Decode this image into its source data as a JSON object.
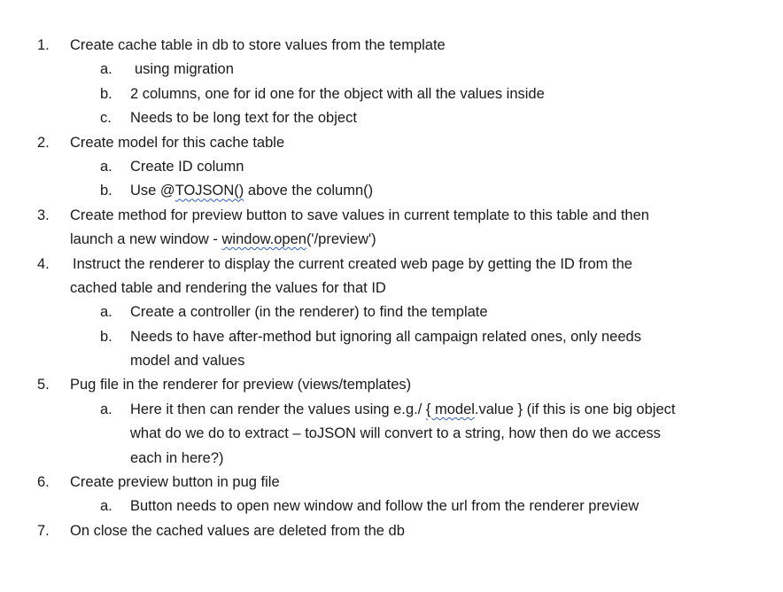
{
  "doc": {
    "items": [
      {
        "num": "1.",
        "text": "Create cache table in db to store values from the template"
      },
      {
        "num": "a.",
        "text": "using migration"
      },
      {
        "num": "b.",
        "text": "2 columns, one for id one for the object with all the values inside"
      },
      {
        "num": "c.",
        "text": "Needs to be long text for the object"
      },
      {
        "num": "2.",
        "text": "Create model for this cache table"
      },
      {
        "num": "a.",
        "text": "Create ID column"
      },
      {
        "num": "b.",
        "pre": "Use @",
        "link": "TOJSON()",
        "post": " above the column()"
      },
      {
        "num": "3.",
        "text": "Create method for preview button to save values in current template to this table and then"
      },
      {
        "pre": "launch a new window - ",
        "link": "window.open",
        "post": "('/preview')"
      },
      {
        "num": "4.",
        "text": "Instruct the renderer to display the current created web page by getting the ID from the"
      },
      {
        "text": "cached table and rendering the values for that ID"
      },
      {
        "num": "a.",
        "text": "Create a controller (in the renderer) to find the template"
      },
      {
        "num": "b.",
        "text": "Needs to have after-method but ignoring all campaign related ones, only needs"
      },
      {
        "text": "model and values"
      },
      {
        "num": "5.",
        "text": "Pug file in the renderer for preview (views/templates)"
      },
      {
        "num": "a.",
        "pre": "Here it then can render the values using e.g./ ",
        "link": "{ model",
        "post": ".value } (if this is one big object"
      },
      {
        "text": "what do we do to extract – toJSON will convert to a string, how then do we access"
      },
      {
        "text": "each in here?)"
      },
      {
        "num": "6.",
        "text": "Create preview button in pug file"
      },
      {
        "num": "a.",
        "text": "Button needs to open new window and follow the url from the renderer preview"
      },
      {
        "num": "7.",
        "text": "On close the cached values are deleted from the db"
      }
    ]
  }
}
